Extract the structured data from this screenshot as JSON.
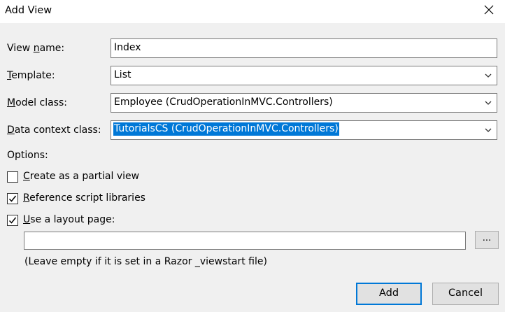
{
  "window": {
    "title": "Add View"
  },
  "form": {
    "view_name": {
      "label_pre": "View ",
      "label_u": "n",
      "label_post": "ame:",
      "value": "Index"
    },
    "template": {
      "label_pre": "",
      "label_u": "T",
      "label_post": "emplate:",
      "value": "List"
    },
    "model_class": {
      "label_pre": "",
      "label_u": "M",
      "label_post": "odel class:",
      "value": "Employee (CrudOperationInMVC.Controllers)"
    },
    "data_context_class": {
      "label_pre": "",
      "label_u": "D",
      "label_post": "ata context class:",
      "value": "TutorialsCS (CrudOperationInMVC.Controllers)"
    }
  },
  "options": {
    "heading": "Options:",
    "partial_view": {
      "label_u": "C",
      "label_rest": "reate as a partial view",
      "checked": false
    },
    "reference_scripts": {
      "label_u": "R",
      "label_rest": "eference script libraries",
      "checked": true
    },
    "use_layout": {
      "label_u": "U",
      "label_rest": "se a layout page:",
      "checked": true
    },
    "layout_path": {
      "value": ""
    },
    "browse_label": "...",
    "hint": "(Leave empty if it is set in a Razor _viewstart file)"
  },
  "buttons": {
    "add": "Add",
    "cancel": "Cancel"
  },
  "colors": {
    "selection": "#0078d7",
    "dialog_bg": "#f0f0f0"
  }
}
